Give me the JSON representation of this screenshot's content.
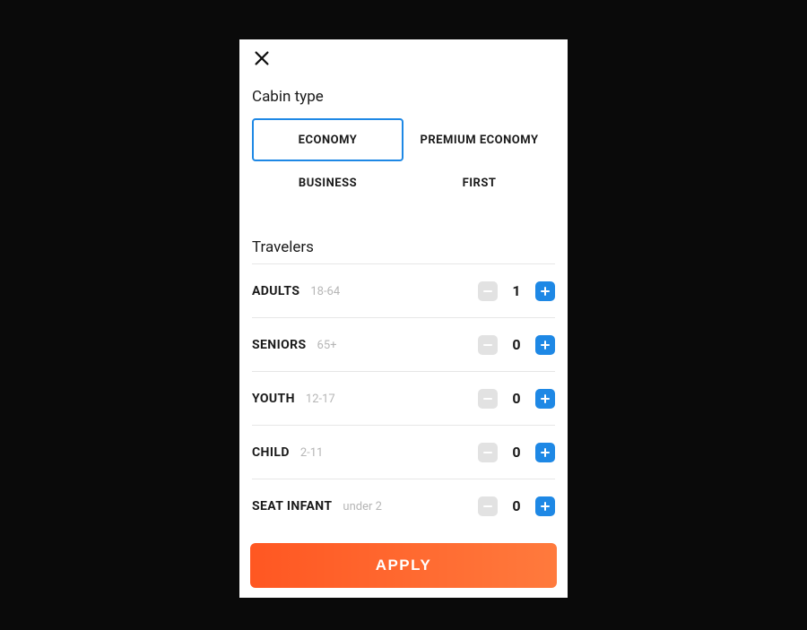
{
  "cabin_section_title": "Cabin type",
  "cabin_options": [
    {
      "label": "ECONOMY",
      "selected": true
    },
    {
      "label": "PREMIUM ECONOMY",
      "selected": false
    },
    {
      "label": "BUSINESS",
      "selected": false
    },
    {
      "label": "FIRST",
      "selected": false
    }
  ],
  "travelers_section_title": "Travelers",
  "travelers": [
    {
      "label": "ADULTS",
      "hint": "18-64",
      "count": 1
    },
    {
      "label": "SENIORS",
      "hint": "65+",
      "count": 0
    },
    {
      "label": "YOUTH",
      "hint": "12-17",
      "count": 0
    },
    {
      "label": "CHILD",
      "hint": "2-11",
      "count": 0
    },
    {
      "label": "SEAT INFANT",
      "hint": "under 2",
      "count": 0
    }
  ],
  "apply_label": "APPLY",
  "icons": {
    "close": "close-icon",
    "minus": "minus-icon",
    "plus": "plus-icon"
  },
  "colors": {
    "accent_blue": "#1e88e5",
    "apply_gradient_start": "#ff5722",
    "apply_gradient_end": "#ff7a3d"
  }
}
